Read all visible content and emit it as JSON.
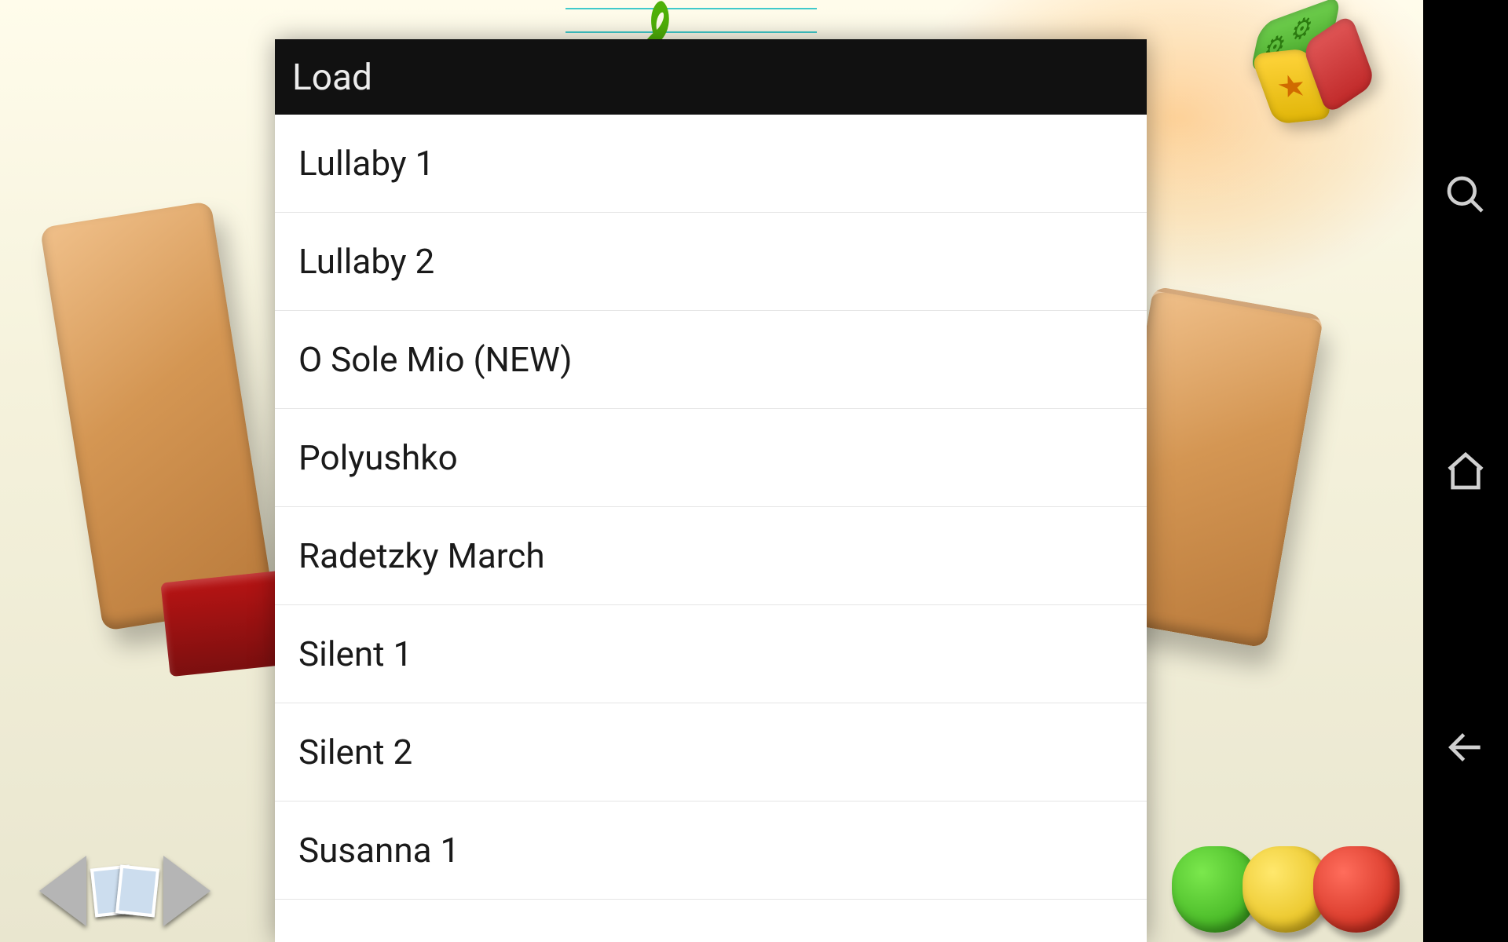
{
  "dialog": {
    "title": "Load",
    "items": [
      "Lullaby 1",
      "Lullaby 2",
      "O Sole Mio (NEW)",
      "Polyushko",
      "Radetzky March",
      "Silent 1",
      "Silent 2",
      "Susanna 1"
    ]
  },
  "icons": {
    "search": "search-icon",
    "home": "home-icon",
    "back": "back-icon",
    "settings_cube": "settings-cube",
    "prev": "prev-arrow",
    "next": "next-arrow",
    "thumbs": "thumbnail-stack"
  },
  "colors": {
    "dialog_header_bg": "#111111",
    "dialog_bg": "#ffffff",
    "screen_bg": "#f5f2dc"
  }
}
